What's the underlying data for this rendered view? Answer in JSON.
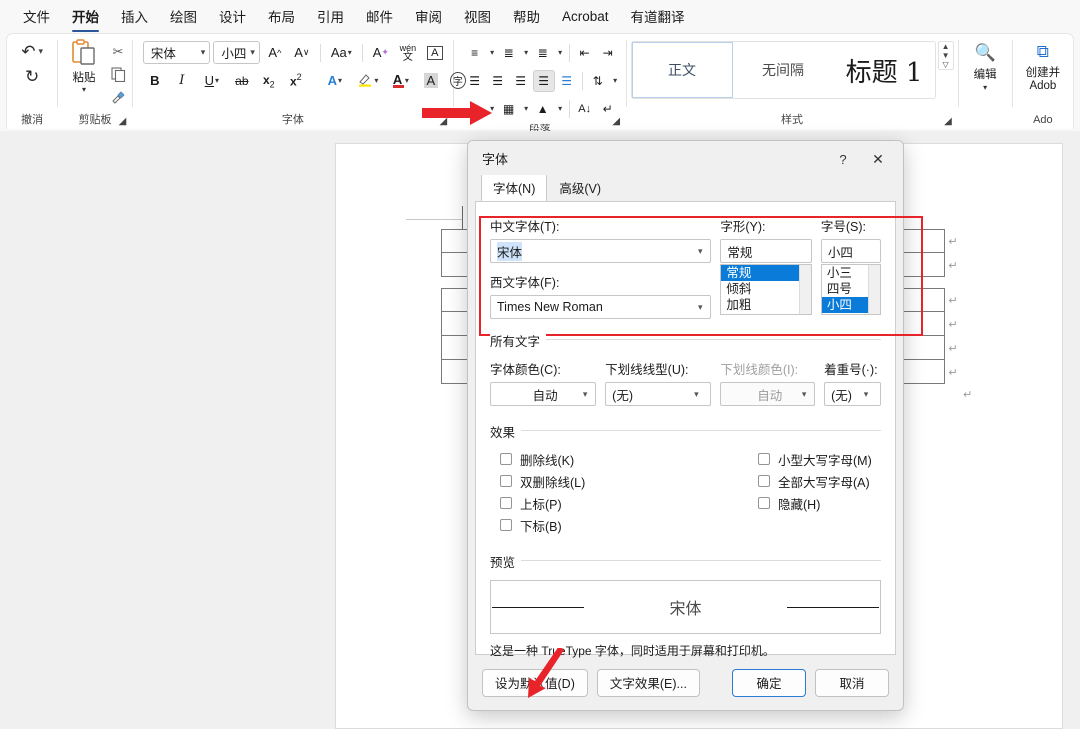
{
  "app": {
    "ribbon_tabs": [
      {
        "label": "文件",
        "active": false
      },
      {
        "label": "开始",
        "active": true
      },
      {
        "label": "插入",
        "active": false
      },
      {
        "label": "绘图",
        "active": false
      },
      {
        "label": "设计",
        "active": false
      },
      {
        "label": "布局",
        "active": false
      },
      {
        "label": "引用",
        "active": false
      },
      {
        "label": "邮件",
        "active": false
      },
      {
        "label": "审阅",
        "active": false
      },
      {
        "label": "视图",
        "active": false
      },
      {
        "label": "帮助",
        "active": false
      },
      {
        "label": "Acrobat",
        "active": false
      },
      {
        "label": "有道翻译",
        "active": false
      }
    ]
  },
  "ribbon": {
    "undo": {
      "group_label": "撤消",
      "undo_icon": "undo-arrow",
      "redo_icon": "redo-arrow"
    },
    "clipboard": {
      "group_label": "剪贴板",
      "paste_label": "粘贴",
      "cut_icon": "scissors-icon",
      "copy_icon": "copy-icon",
      "format_painter_icon": "format-painter-icon"
    },
    "font": {
      "group_label": "字体",
      "font_name": "宋体",
      "font_size": "小四",
      "grow_font": "A",
      "shrink_font": "A",
      "change_case": "Aa",
      "clear_formatting": "A",
      "phonetic_guide": "wén",
      "char_border": "A",
      "bold": "B",
      "italic": "I",
      "underline": "U",
      "strikethrough": "ab",
      "subscript": "x",
      "superscript": "x",
      "text_effects": "A",
      "highlight": "pen",
      "font_color": "A",
      "char_shading": "A",
      "enclose_char": "字"
    },
    "paragraph": {
      "group_label": "段落"
    },
    "styles": {
      "group_label": "样式",
      "items": [
        {
          "label": "正文",
          "selected": true
        },
        {
          "label": "无间隔",
          "selected": false
        },
        {
          "label": "标题 1",
          "selected": false
        }
      ]
    },
    "editing": {
      "group_label": "编辑",
      "label": "编辑",
      "icon": "search-icon"
    },
    "adobe": {
      "group_label": "Ado",
      "line1": "创建并",
      "line2": "Adob",
      "icon": "adobe-pdf-icon"
    }
  },
  "dialog": {
    "title": "字体",
    "help_icon": "question-mark-icon",
    "close_icon": "close-icon",
    "tabs": [
      {
        "label": "字体(N)",
        "active": true
      },
      {
        "label": "高级(V)",
        "active": false
      }
    ],
    "fields": {
      "cn_font_label": "中文字体(T):",
      "cn_font_value": "宋体",
      "latin_font_label": "西文字体(F):",
      "latin_font_value": "Times New Roman",
      "style_label": "字形(Y):",
      "style_value": "常规",
      "style_options": [
        "常规",
        "倾斜",
        "加粗"
      ],
      "style_selected": "常规",
      "size_label": "字号(S):",
      "size_value": "小四",
      "size_options": [
        "小三",
        "四号",
        "小四"
      ],
      "size_selected": "小四"
    },
    "all_text": {
      "title": "所有文字",
      "font_color_label": "字体颜色(C):",
      "font_color_value": "自动",
      "underline_style_label": "下划线线型(U):",
      "underline_style_value": "(无)",
      "underline_color_label": "下划线颜色(I):",
      "underline_color_value": "自动",
      "emphasis_label": "着重号(·):",
      "emphasis_value": "(无)"
    },
    "effects": {
      "title": "效果",
      "left": [
        {
          "label": "删除线(K)",
          "checked": false
        },
        {
          "label": "双删除线(L)",
          "checked": false
        },
        {
          "label": "上标(P)",
          "checked": false
        },
        {
          "label": "下标(B)",
          "checked": false
        }
      ],
      "right": [
        {
          "label": "小型大写字母(M)",
          "checked": false
        },
        {
          "label": "全部大写字母(A)",
          "checked": false
        },
        {
          "label": "隐藏(H)",
          "checked": false
        }
      ]
    },
    "preview": {
      "title": "预览",
      "sample_text": "宋体",
      "note": "这是一种 TrueType 字体，同时适用于屏幕和打印机。"
    },
    "buttons": {
      "set_default": "设为默认值(D)",
      "text_effects": "文字效果(E)...",
      "ok": "确定",
      "cancel": "取消"
    }
  },
  "annotations": {
    "highlight_color": "#e8242a",
    "arrow_color": "#e8242a",
    "arrow_to_font_launcher": "arrow-icon",
    "arrow_to_set_default": "arrow-icon"
  },
  "colors": {
    "accent": "#2b579a",
    "selection_blue": "#0a7bd8",
    "text_select_highlight": "#cfe3fa",
    "ribbon_bg": "#ffffff",
    "canvas_bg": "#f0f0f0"
  }
}
